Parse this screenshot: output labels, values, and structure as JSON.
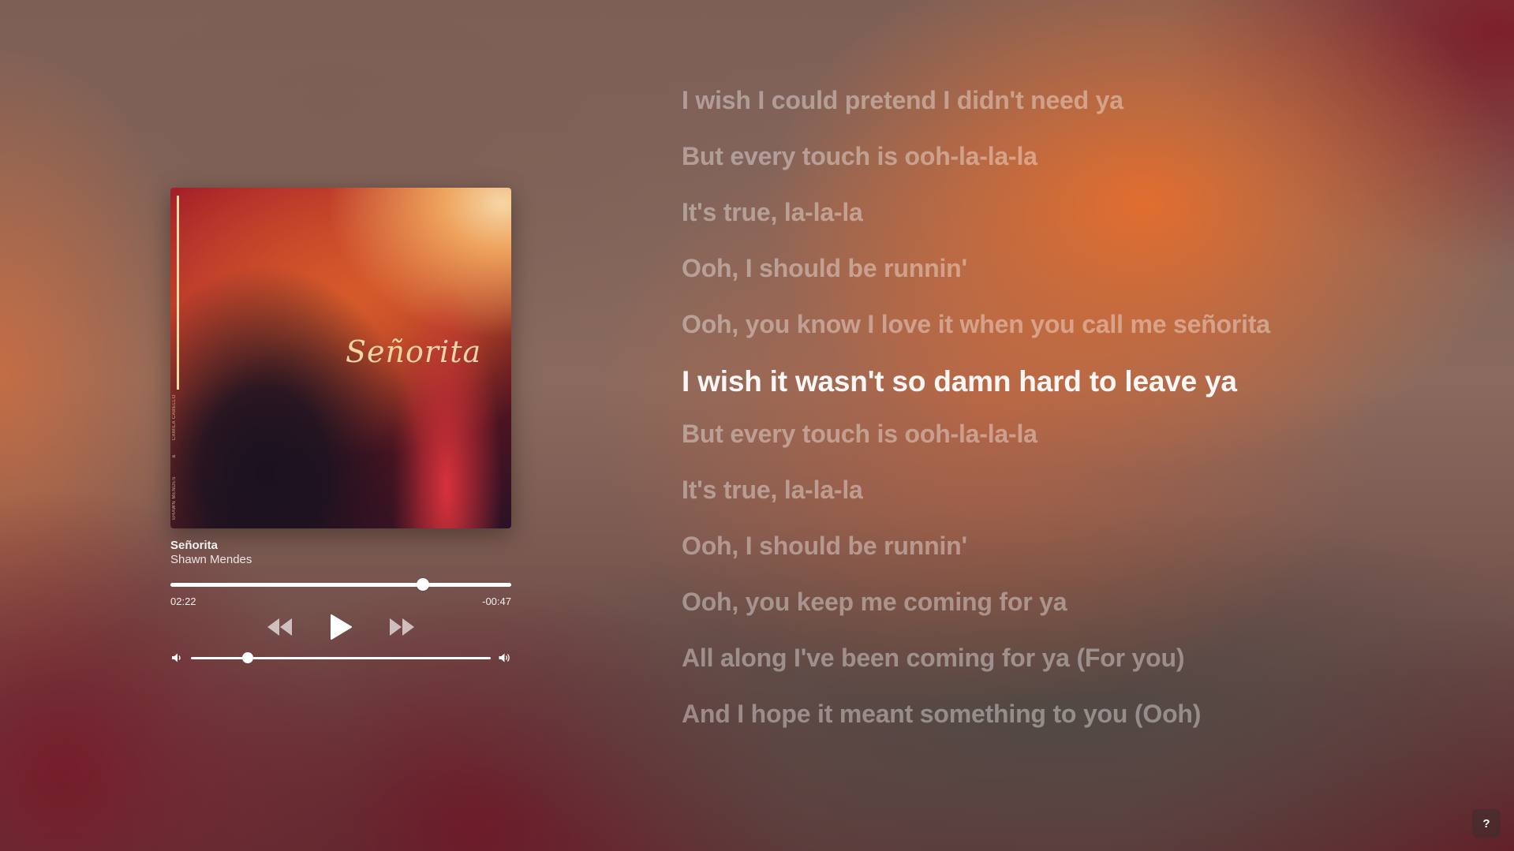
{
  "track": {
    "title": "Señorita",
    "artist": "Shawn Mendes",
    "elapsed": "02:22",
    "remaining": "-00:47",
    "progress_fraction": 0.74
  },
  "album_art": {
    "script_title": "Señorita",
    "side_text_top": "CAMILA CABELLO",
    "side_text_mid": "&",
    "side_text_bottom": "SHAWN MENDES"
  },
  "volume": {
    "level_fraction": 0.19
  },
  "controls": {
    "rewind_icon": "rewind-icon",
    "play_icon": "play-icon",
    "forward_icon": "fast-forward-icon",
    "volume_low_icon": "volume-low-icon",
    "volume_high_icon": "volume-high-icon"
  },
  "lyrics": [
    "I wish I could pretend I didn't need ya",
    "But every touch is ooh-la-la-la",
    "It's true, la-la-la",
    "Ooh, I should be runnin'",
    "Ooh, you know I love it when you call me señorita",
    "I wish it wasn't so damn hard to leave ya",
    "But every touch is ooh-la-la-la",
    "It's true, la-la-la",
    "Ooh, I should be runnin'",
    "Ooh, you keep me coming for ya",
    "All along I've been coming for ya (For you)",
    "And I hope it meant something to you (Ooh)"
  ],
  "active_lyric_index": 5,
  "help": {
    "label": "?"
  },
  "colors": {
    "accent": "#e07236",
    "text_active": "#ffffff"
  }
}
